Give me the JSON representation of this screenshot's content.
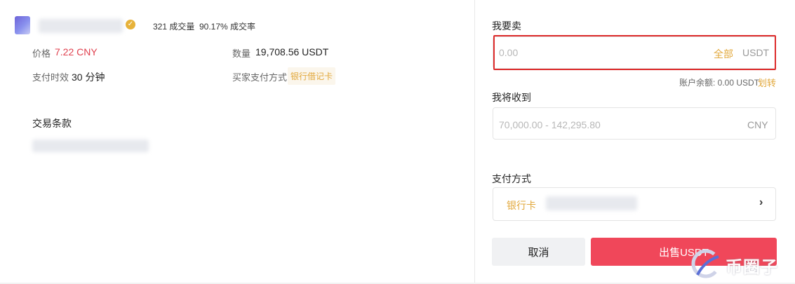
{
  "merchant": {
    "completed_orders": "321 成交量",
    "completion_rate": "90.17% 成交率"
  },
  "order_info": {
    "price_label": "价格",
    "price_value": "7.22 CNY",
    "quantity_label": "数量",
    "quantity_value": "19,708.56 USDT",
    "payment_time_label": "支付时效",
    "payment_time_value": "30 分钟",
    "buyer_payment_label": "买家支付方式",
    "buyer_payment_tag": "银行借记卡"
  },
  "terms": {
    "title": "交易条款"
  },
  "sell_form": {
    "sell_label": "我要卖",
    "sell_placeholder": "0.00",
    "all_button": "全部",
    "sell_unit": "USDT",
    "balance_text": "账户余额: 0.00 USDT",
    "transfer_link": "划转",
    "receive_label": "我将收到",
    "receive_placeholder": "70,000.00 - 142,295.80",
    "receive_unit": "CNY",
    "payment_label": "支付方式",
    "payment_method": "银行卡",
    "payment_chevron": "›",
    "cancel_button": "取消",
    "sell_button": "出售USDT"
  },
  "watermark": {
    "text": "币圈子"
  },
  "colors": {
    "accent_gold": "#e2a83c",
    "price_red": "#e0414f",
    "sell_button": "#f0475a",
    "highlight_box": "#dd2b2b"
  }
}
